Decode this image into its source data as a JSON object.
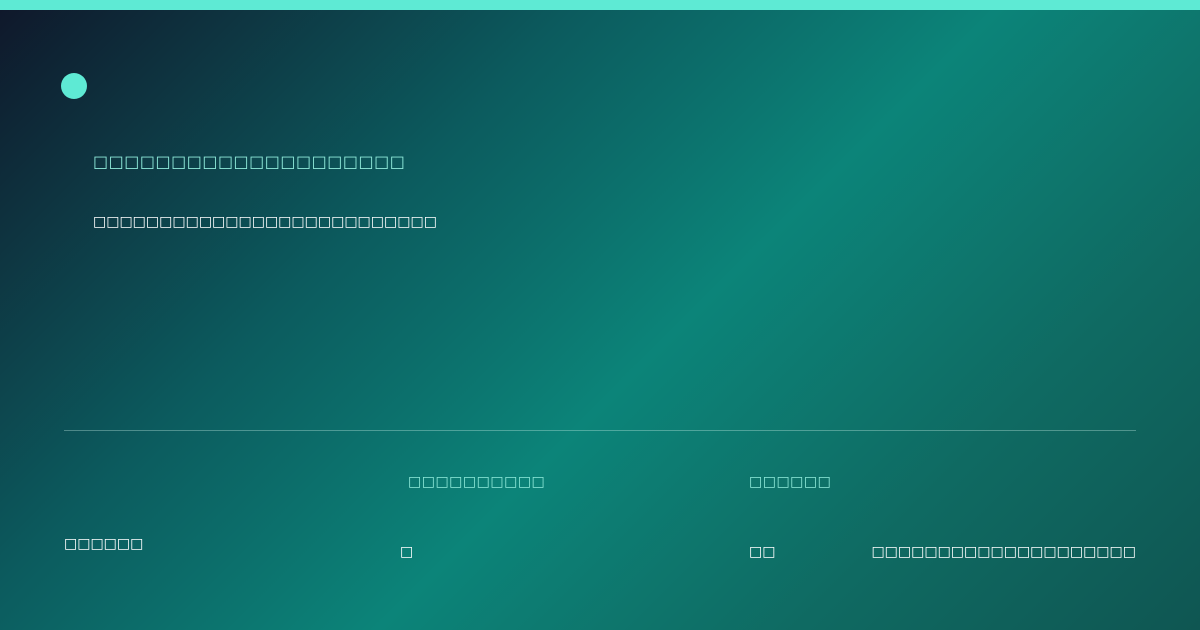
{
  "colors": {
    "accent": "#5eead4",
    "accent_text": "#8ee9d9",
    "text": "#ffffff",
    "background_dark": "#0f172a",
    "background_teal": "#0c8479"
  },
  "brand": {
    "icon": "circle-logo-icon"
  },
  "hero": {
    "headline": "□□□□□□□□□□□□□□□□□□□□",
    "subline": "□□□□□□□□□□□□□□□□□□□□□□□□□□"
  },
  "footer": {
    "left_text": "□□□□□□",
    "right_text": "□□□□□□□□□□□□□□□□□□□□",
    "stats": [
      {
        "label": "□□□□□□□□□□",
        "value": "□"
      },
      {
        "label": "□□□□□□",
        "value": "□□"
      }
    ]
  }
}
